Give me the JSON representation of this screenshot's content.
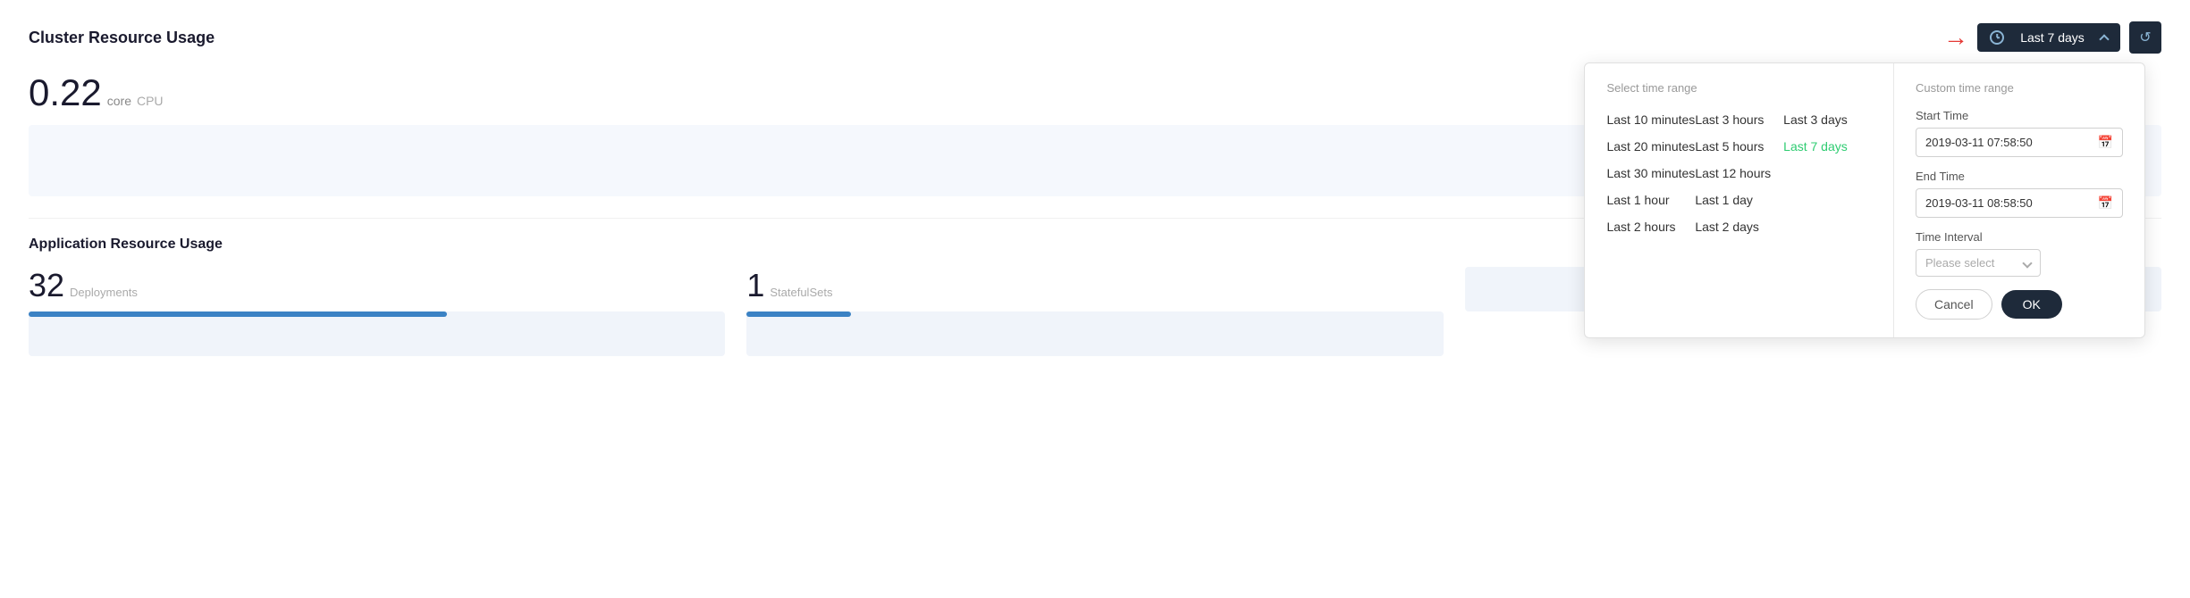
{
  "header": {
    "cluster_title": "Cluster Resource Usage",
    "app_title": "Application Resource Usage",
    "time_range_label": "Last 7 days",
    "refresh_icon": "↺"
  },
  "cluster_metric": {
    "value": "0.22",
    "unit": "core",
    "label": "CPU"
  },
  "app_metrics": [
    {
      "value": "32",
      "label": "Deployments"
    },
    {
      "value": "1",
      "label": "StatefulSets"
    },
    {
      "value": "",
      "label": ""
    }
  ],
  "dropdown": {
    "select_time_range_label": "Select time range",
    "custom_time_range_label": "Custom time range",
    "time_options": [
      {
        "label": "Last 10 minutes",
        "col": 0
      },
      {
        "label": "Last 3 hours",
        "col": 1
      },
      {
        "label": "Last 3 days",
        "col": 2
      },
      {
        "label": "Last 20 minutes",
        "col": 0
      },
      {
        "label": "Last 5 hours",
        "col": 1
      },
      {
        "label": "Last 7 days",
        "col": 2,
        "active": true
      },
      {
        "label": "Last 30 minutes",
        "col": 0
      },
      {
        "label": "Last 12 hours",
        "col": 1
      },
      {
        "label": "",
        "col": 2
      },
      {
        "label": "Last 1 hour",
        "col": 0
      },
      {
        "label": "Last 1 day",
        "col": 1
      },
      {
        "label": "",
        "col": 2
      },
      {
        "label": "Last 2 hours",
        "col": 0
      },
      {
        "label": "Last 2 days",
        "col": 1
      },
      {
        "label": "",
        "col": 2
      }
    ],
    "start_time_label": "Start Time",
    "start_time_value": "2019-03-11 07:58:50",
    "end_time_label": "End Time",
    "end_time_value": "2019-03-11 08:58:50",
    "interval_label": "Time Interval",
    "interval_placeholder": "Please select",
    "cancel_label": "Cancel",
    "ok_label": "OK"
  },
  "colors": {
    "accent_blue": "#3b82c4",
    "dark_bg": "#1e2a3a",
    "active_green": "#2ecc71"
  }
}
